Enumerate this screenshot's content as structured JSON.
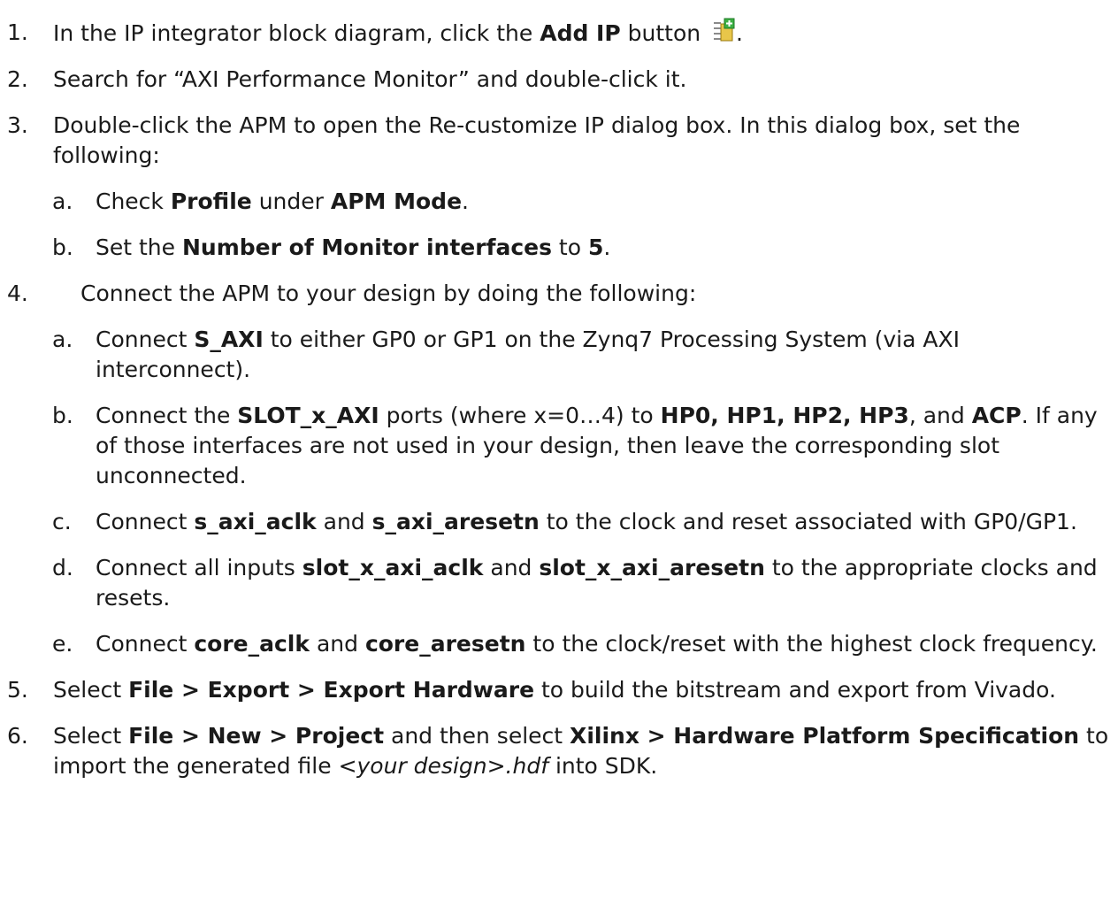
{
  "steps": [
    {
      "num": "1.",
      "t1": "In the IP integrator block diagram, click the ",
      "b1": "Add IP",
      "t2": " button ",
      "icon": "add-ip-icon",
      "t3": "."
    },
    {
      "num": "2.",
      "t1": "Search for “AXI Performance Monitor” and double-click it."
    },
    {
      "num": "3.",
      "t1": "Double-click the APM to open the Re-customize IP dialog box. In this dialog box, set the following:",
      "subs": [
        {
          "num": "a.",
          "t1": "Check ",
          "b1": "Profile",
          "t2": " under ",
          "b2": "APM Mode",
          "t3": "."
        },
        {
          "num": "b.",
          "t1": "Set the ",
          "b1": "Number of Monitor interfaces",
          "t2": " to ",
          "b2": "5",
          "t3": "."
        }
      ]
    },
    {
      "num": "4.",
      "t1": "Connect the APM to your design by doing the following:",
      "subs": [
        {
          "num": "a.",
          "t1": "Connect ",
          "b1": "S_AXI",
          "t2": " to either GP0 or GP1 on the Zynq7 Processing System (via AXI interconnect)."
        },
        {
          "num": "b.",
          "t1": "Connect the ",
          "b1": "SLOT_x_AXI",
          "t2": " ports (where x=0…4) to ",
          "b2": "HP0, HP1, HP2, HP3",
          "t3": ", and ",
          "b3": "ACP",
          "t4": ". If any of those interfaces are not used in your design, then leave the corresponding slot unconnected."
        },
        {
          "num": "c.",
          "t1": "Connect ",
          "b1": "s_axi_aclk",
          "t2": " and ",
          "b2": "s_axi_aresetn",
          "t3": " to the clock and reset associated with GP0/GP1."
        },
        {
          "num": "d.",
          "t1": "Connect all inputs ",
          "b1": "slot_x_axi_aclk",
          "t2": " and ",
          "b2": "slot_x_axi_aresetn",
          "t3": " to the appropriate clocks and resets."
        },
        {
          "num": "e.",
          "t1": "Connect ",
          "b1": "core_aclk",
          "t2": " and ",
          "b2": "core_aresetn",
          "t3": " to the clock/reset with the highest clock frequency."
        }
      ]
    },
    {
      "num": "5.",
      "t1": "Select ",
      "b1": "File > Export > Export Hardware",
      "t2": " to build the bitstream and export from Vivado."
    },
    {
      "num": "6.",
      "t1": "Select ",
      "b1": "File > New > Project",
      "t2": " and then select ",
      "b2": "Xilinx > Hardware Platform Specification",
      "t3": " to import the generated file ",
      "i1": "<your design>.hdf",
      "t4": " into SDK."
    }
  ],
  "colors": {
    "text": "#1a1a1a",
    "icon_green": "#3cb043",
    "icon_yellow": "#e8c64a",
    "icon_gray": "#8a8a8a"
  }
}
